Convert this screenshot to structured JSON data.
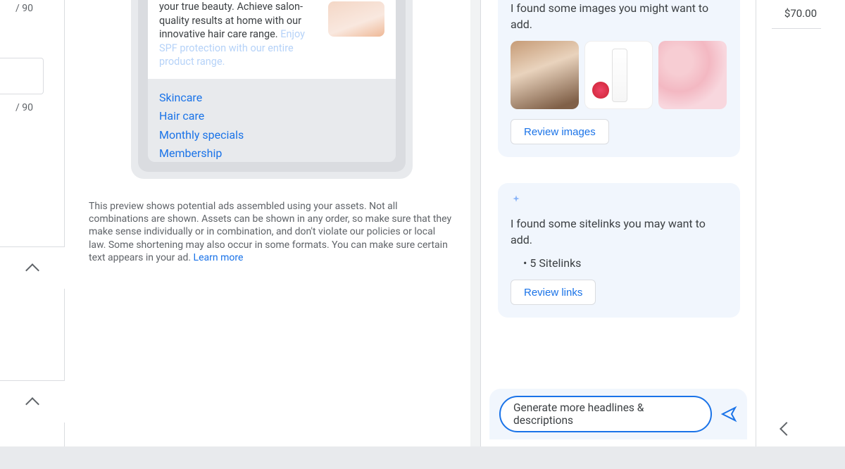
{
  "left": {
    "counter1": "/ 90",
    "counter2": "/ 90"
  },
  "ad": {
    "body_dark": "your true beauty. Achieve salon-quality results at home with our innovative hair care range.",
    "body_faded": "Enjoy SPF protection with our entire product range.",
    "links": [
      "Skincare",
      "Hair care",
      "Monthly specials",
      "Membership"
    ]
  },
  "disclaimer": {
    "text": "This preview shows potential ads assembled using your assets. Not all combinations are shown. Assets can be shown in any order, so make sure that they make sense individually or in combination, and don't violate our policies or local law. Some shortening may also occur in some formats. You can make sure certain text appears in your ad. ",
    "link": "Learn more"
  },
  "chat": {
    "images_msg": "I found some images you might want to add.",
    "review_images": "Review images",
    "sitelinks_msg": "I found some sitelinks you may want to add.",
    "sitelinks_count": "5 Sitelinks",
    "review_links": "Review links",
    "input": "Generate more headlines & descriptions"
  },
  "right": {
    "price": "$70.00"
  }
}
